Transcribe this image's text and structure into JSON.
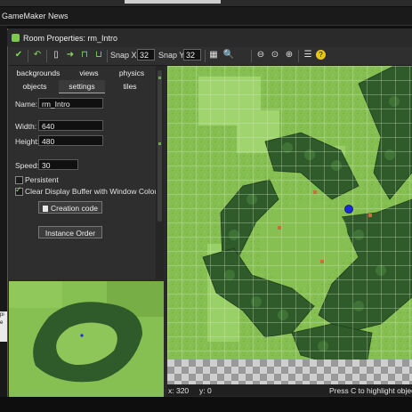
{
  "app": {
    "news_title": "GameMaker News"
  },
  "left_clip": {
    "lines": [
      "pi",
      "e"
    ]
  },
  "window": {
    "title": "Room Properties: rm_Intro"
  },
  "toolbar": {
    "snap_x_label": "Snap X:",
    "snap_x_value": "32",
    "snap_y_label": "Snap Y:",
    "snap_y_value": "32"
  },
  "tabs": {
    "row1": [
      "backgrounds",
      "views",
      "physics"
    ],
    "row2": [
      "objects",
      "settings",
      "tiles"
    ],
    "selected": "settings"
  },
  "settings": {
    "name_label": "Name:",
    "name_value": "rm_Intro",
    "width_label": "Width:",
    "width_value": "640",
    "height_label": "Height:",
    "height_value": "480",
    "speed_label": "Speed:",
    "speed_value": "30",
    "persistent_label": "Persistent",
    "persistent_checked": false,
    "clear_label": "Clear Display Buffer with Window Colour",
    "clear_checked": true,
    "creation_code_label": "Creation code",
    "instance_order_label": "Instance Order"
  },
  "status": {
    "x": "x: 320",
    "y": "y: 0",
    "hint": "Press C to highlight objec"
  },
  "colors": {
    "grass": "#7fb64b",
    "tree": "#2f5a2a",
    "object": "#1b2bd6",
    "accent_green": "#7ec850"
  }
}
